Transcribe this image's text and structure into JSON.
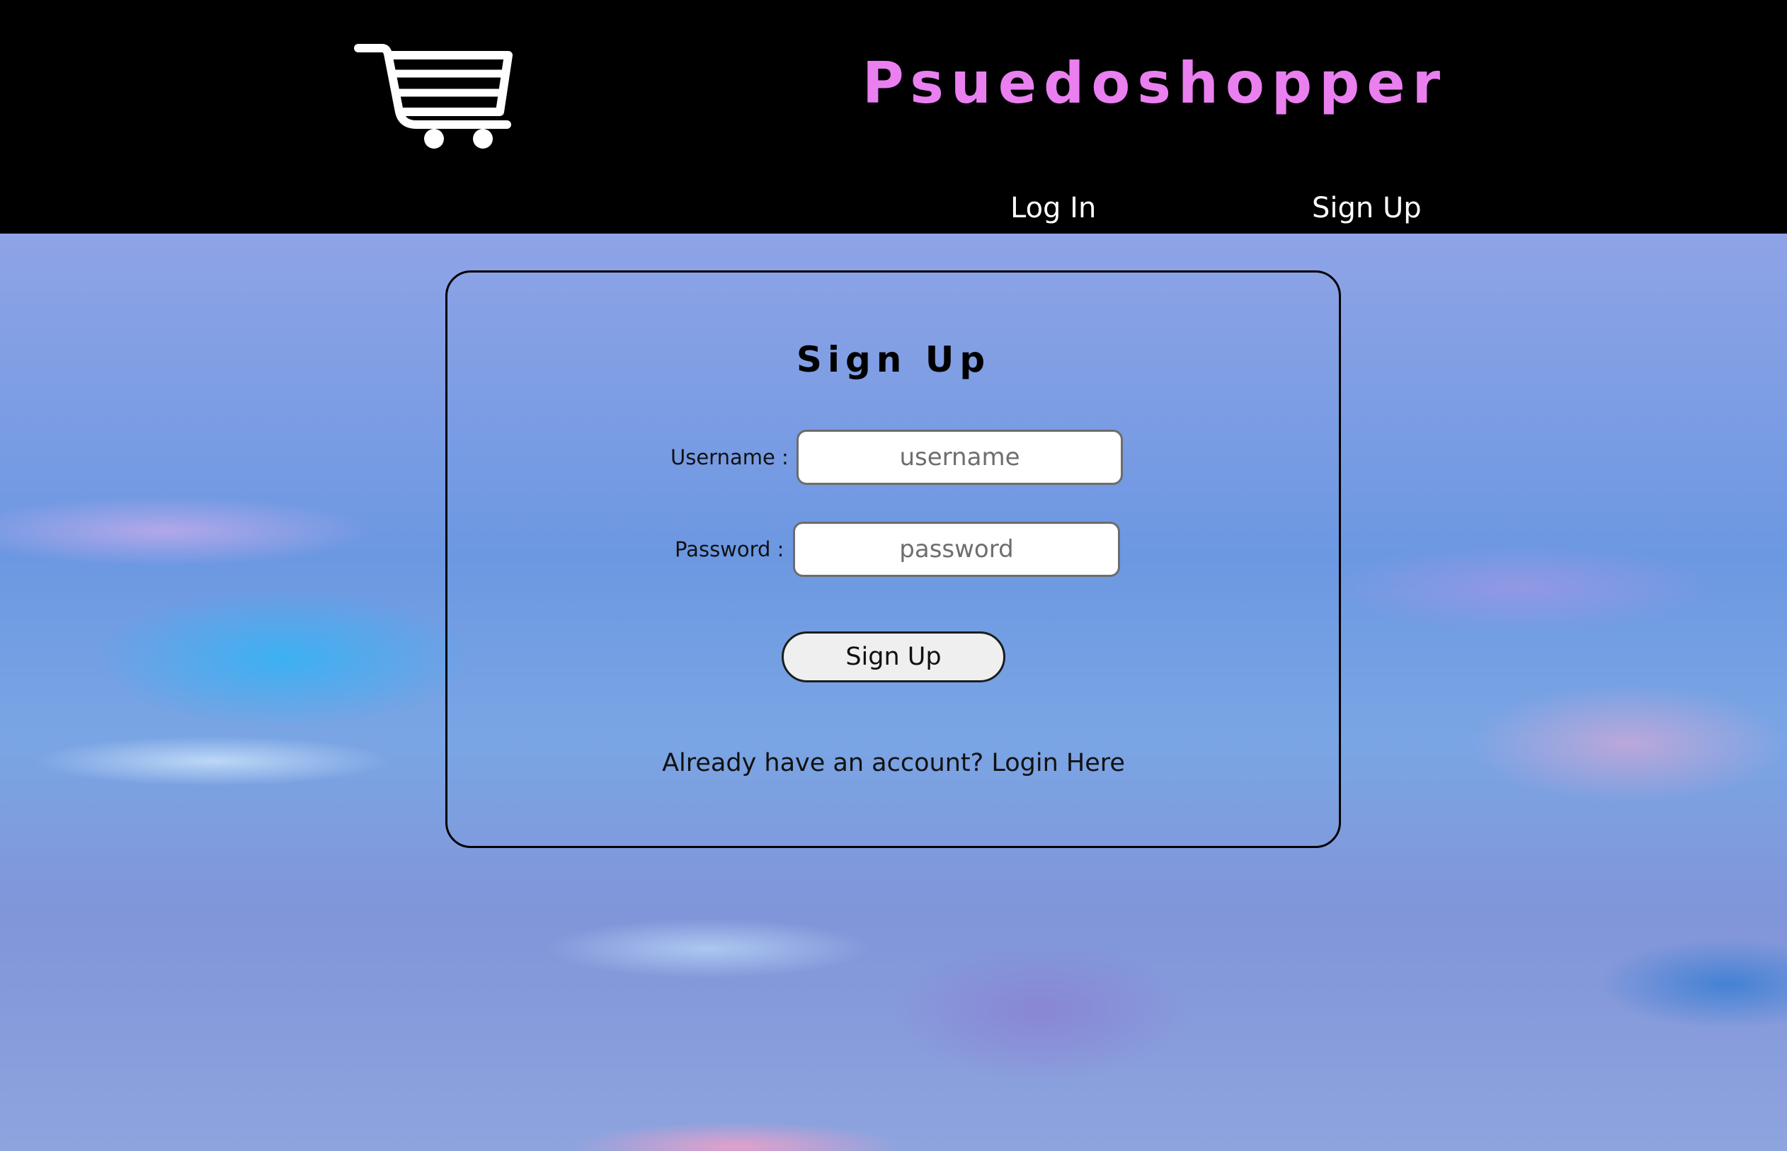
{
  "header": {
    "brand_title": "Psuedoshopper",
    "brand_color": "#ea7ff0",
    "logo_icon": "shopping-cart-icon",
    "nav": {
      "login_label": "Log In",
      "signup_label": "Sign Up"
    }
  },
  "signup_form": {
    "title": "Sign Up",
    "username_label": "Username :",
    "username_placeholder": "username",
    "username_value": "",
    "password_label": "Password :",
    "password_placeholder": "password",
    "password_value": "",
    "submit_label": "Sign Up",
    "already_text": "Already have an account?",
    "login_link_label": "Login Here"
  },
  "colors": {
    "header_background": "#000000",
    "nav_text": "#ffffff",
    "card_border": "#000000",
    "button_background": "#efefef"
  }
}
